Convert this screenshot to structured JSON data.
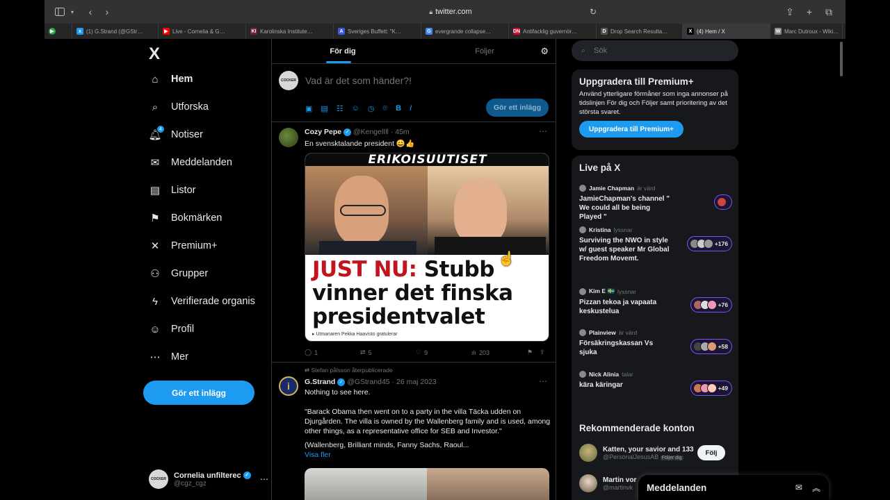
{
  "browser": {
    "url": "twitter.com",
    "tabs": [
      {
        "label": "(1) G.Strand (@GStr…",
        "fav": "x",
        "color": "#1d9bf0"
      },
      {
        "label": "Live - Cornelia & G…",
        "fav": "▶",
        "color": "#ff0000"
      },
      {
        "label": "Karolinska Institute…",
        "fav": "KI",
        "color": "#7b2036"
      },
      {
        "label": "Sveriges Buffett: \"K…",
        "fav": "A",
        "color": "#3b5bdb"
      },
      {
        "label": "evergrande collapse…",
        "fav": "G",
        "color": "#4285f4"
      },
      {
        "label": "Antifacklig guvernör…",
        "fav": "DN",
        "color": "#c8102e"
      },
      {
        "label": "Drop Search Resulta…",
        "fav": "D",
        "color": "#555555"
      },
      {
        "label": "(4) Hem / X",
        "fav": "X",
        "color": "#000000"
      },
      {
        "label": "Marc Dutroux - Wiki…",
        "fav": "W",
        "color": "#888888"
      }
    ]
  },
  "nav": {
    "logo": "X",
    "items": [
      {
        "label": "Hem",
        "icon": "home-icon",
        "glyph": "⌂"
      },
      {
        "label": "Utforska",
        "icon": "search-icon",
        "glyph": "⌕"
      },
      {
        "label": "Notiser",
        "icon": "bell-icon",
        "glyph": "🔔︎"
      },
      {
        "label": "Meddelanden",
        "icon": "mail-icon",
        "glyph": "✉"
      },
      {
        "label": "Listor",
        "icon": "list-icon",
        "glyph": "▤"
      },
      {
        "label": "Bokmärken",
        "icon": "bookmark-icon",
        "glyph": "⚑"
      },
      {
        "label": "Premium+",
        "icon": "x-premium-icon",
        "glyph": "✕"
      },
      {
        "label": "Grupper",
        "icon": "people-icon",
        "glyph": "⚇"
      },
      {
        "label": "Verifierade organis",
        "icon": "lightning-icon",
        "glyph": "ϟ"
      },
      {
        "label": "Profil",
        "icon": "person-icon",
        "glyph": "☺"
      },
      {
        "label": "Mer",
        "icon": "more-circle-icon",
        "glyph": "⋯"
      }
    ],
    "notif_count": "4",
    "post_button": "Gör ett inlägg",
    "account_name": "Cornelia unfilterec",
    "account_handle": "@cgz_cgz",
    "account_avatar_text": "COCKER"
  },
  "main": {
    "tab_for_you": "För dig",
    "tab_following": "Följer",
    "compose_placeholder": "Vad är det som händer?!",
    "compose_button": "Gör ett inlägg",
    "tweets": [
      {
        "name": "Cozy Pepe",
        "handle": "@KengelIll",
        "time": "45m",
        "text": "En svensktalande president 😄👍",
        "media_banner": "ERIKOISUUTISET",
        "media_headline_red": "JUST NU:",
        "media_headline_1": "Stubb",
        "media_headline_2": "vinner det finska",
        "media_headline_3": "presidentvalet",
        "media_caption": "▸ Utmanaren Pekka Haavisto gratulerar",
        "replies": "1",
        "retweets": "5",
        "likes": "9",
        "views": "203"
      },
      {
        "retweeted_by": "Stefan pålsson återpublicerade",
        "name": "G.Strand",
        "handle": "@GStrand45",
        "time": "26 maj 2023",
        "line1": "Nothing to see here.",
        "line2": "\"Barack Obama then went on to a party in the villa Täcka udden on Djurgården. The villa is owned by the Wallenberg family and is used, among other things, as a representative office for SEB and Investor.\"",
        "line3": "(Wallenberg, Brilliant minds, Fanny Sachs, Raoul...",
        "show_more": "Visa fler"
      }
    ]
  },
  "right": {
    "search_placeholder": "Sök",
    "premium": {
      "title": "Uppgradera till Premium+",
      "text": "Använd ytterligare förmåner som inga annonser på tidslinjen För dig och Följer samt prioritering av det största svaret.",
      "button": "Uppgradera till Premium+"
    },
    "live": {
      "title": "Live på X",
      "items": [
        {
          "host": "Jamie Chapman",
          "role": "är värd",
          "title": "JamieChapman's channel \" We could all be being Played \"",
          "count": ""
        },
        {
          "host": "Kristina",
          "role": "lyssnar",
          "title": "Surviving the NWO in style w/ guest speaker Mr Global Freedom Movemt.",
          "count": "+176"
        },
        {
          "host": "Kim E 🇸🇪",
          "role": "lyssnar",
          "title": "Pizzan tekoa ja vapaata keskustelua",
          "count": "+76"
        },
        {
          "host": "Plainview",
          "role": "är värd",
          "title": "Försäkringskassan Vs sjuka",
          "count": "+58"
        },
        {
          "host": "Nick Alinia",
          "role": "talar",
          "title": "kära käringar",
          "count": "+49"
        }
      ]
    },
    "recommended": {
      "title": "Rekommenderade konton",
      "accounts": [
        {
          "name": "Katten, your savior and 133",
          "handle": "@PersonalJesusAB",
          "follows_you": "Följer dig",
          "button": "Följ"
        },
        {
          "name": "Martin vor",
          "handle": "@martinvk"
        }
      ]
    }
  },
  "drawer": {
    "title": "Meddelanden"
  },
  "colors": {
    "accent": "#1d9bf0",
    "live_ring": "#7856ff",
    "background": "#000000"
  }
}
